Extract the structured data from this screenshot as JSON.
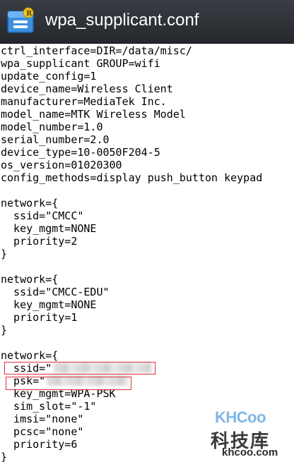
{
  "app": {
    "title": "wpa_supplicant.conf",
    "icon": "file-manager-icon"
  },
  "file": {
    "lines_top": [
      "ctrl_interface=DIR=/data/misc/",
      "wpa_supplicant GROUP=wifi",
      "update_config=1",
      "device_name=Wireless Client",
      "manufacturer=MediaTek Inc.",
      "model_name=MTK Wireless Model",
      "model_number=1.0",
      "serial_number=2.0",
      "device_type=10-0050F204-5",
      "os_version=01020300",
      "config_methods=display push_button keypad"
    ],
    "network1": [
      "network={",
      "  ssid=\"CMCC\"",
      "  key_mgmt=NONE",
      "  priority=2",
      "}"
    ],
    "network2": [
      "network={",
      "  ssid=\"CMCC-EDU\"",
      "  key_mgmt=NONE",
      "  priority=1",
      "}"
    ],
    "network3": [
      "network={",
      "  ssid=\"",
      "  psk=\"",
      "  key_mgmt=WPA-PSK",
      "  sim_slot=\"-1\"",
      "  imsi=\"none\"",
      "  pcsc=\"none\"",
      "  priority=6",
      "}"
    ]
  },
  "watermark": {
    "logo": "KHCoo",
    "chinese": "科技库",
    "url": "khcoo.com"
  },
  "colors": {
    "titlebar": "#2e3135",
    "highlight_box": "#e0303a",
    "text": "#000000"
  }
}
